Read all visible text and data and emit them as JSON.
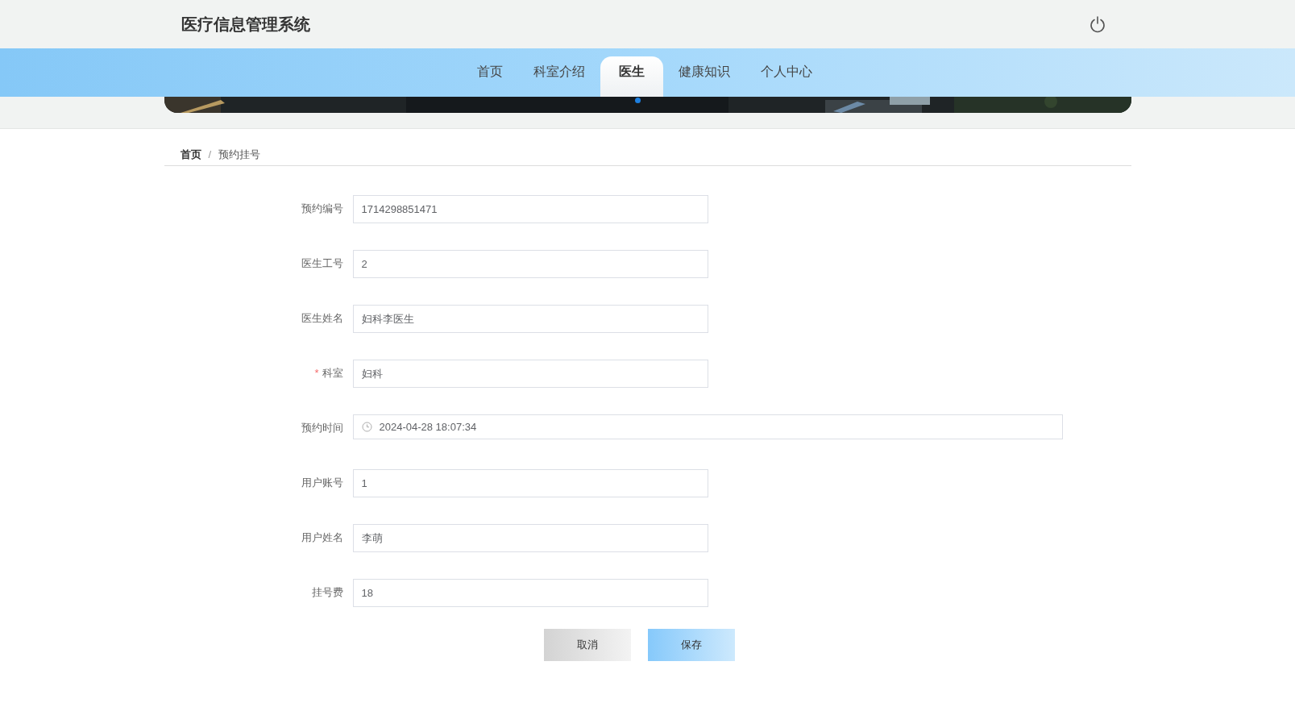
{
  "header": {
    "title": "医疗信息管理系统"
  },
  "nav": [
    {
      "label": "首页",
      "selected": false
    },
    {
      "label": "科室介绍",
      "selected": false
    },
    {
      "label": "医生",
      "selected": true
    },
    {
      "label": "健康知识",
      "selected": false
    },
    {
      "label": "个人中心",
      "selected": false
    }
  ],
  "breadcrumb": {
    "items": [
      "首页",
      "预约挂号"
    ],
    "separator": "/"
  },
  "form": {
    "required_mark": "*",
    "fields": [
      {
        "label": "预约编号",
        "value": "1714298851471",
        "kind": "text",
        "required": false
      },
      {
        "label": "医生工号",
        "value": "2",
        "kind": "text",
        "required": false
      },
      {
        "label": "医生姓名",
        "value": "妇科李医生",
        "kind": "text",
        "required": false
      },
      {
        "label": "科室",
        "value": "妇科",
        "kind": "text",
        "required": true
      },
      {
        "label": "预约时间",
        "value": "2024-04-28 18:07:34",
        "kind": "datetime",
        "required": false
      },
      {
        "label": "用户账号",
        "value": "1",
        "kind": "text",
        "required": false
      },
      {
        "label": "用户姓名",
        "value": "李萌",
        "kind": "text",
        "required": false
      },
      {
        "label": "挂号费",
        "value": "18",
        "kind": "text",
        "required": false
      }
    ],
    "buttons": [
      {
        "label": "取消",
        "kind": "cancel"
      },
      {
        "label": "保存",
        "kind": "save"
      }
    ]
  }
}
